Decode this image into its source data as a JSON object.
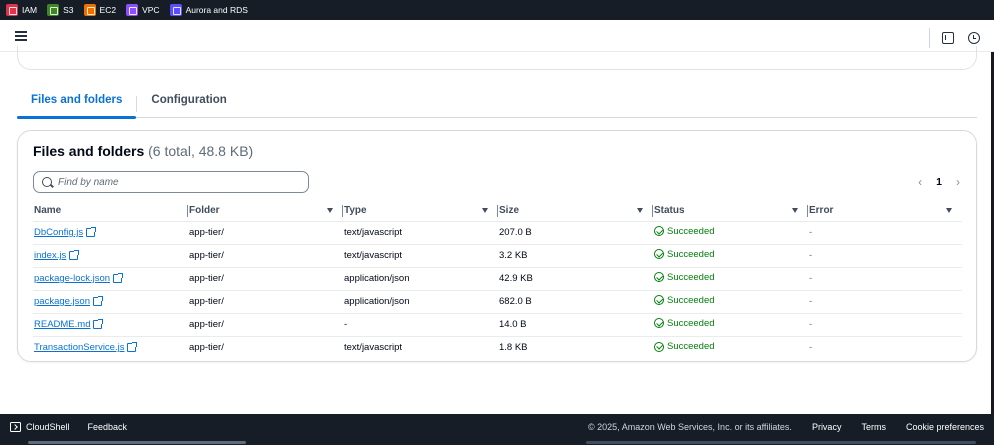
{
  "favorites": [
    {
      "label": "IAM",
      "color": "#dd344c"
    },
    {
      "label": "S3",
      "color": "#3f8624"
    },
    {
      "label": "EC2",
      "color": "#ed7100"
    },
    {
      "label": "VPC",
      "color": "#8c4fff"
    },
    {
      "label": "Aurora and RDS",
      "color": "#5a4fff"
    }
  ],
  "tabs": [
    {
      "label": "Files and folders",
      "active": true
    },
    {
      "label": "Configuration",
      "active": false
    }
  ],
  "card": {
    "title": "Files and folders",
    "count": "(6 total, 48.8 KB)"
  },
  "search": {
    "placeholder": "Find by name"
  },
  "pagination": {
    "page": "1"
  },
  "table": {
    "columns": [
      "Name",
      "Folder",
      "Type",
      "Size",
      "Status",
      "Error"
    ],
    "rows": [
      {
        "name": "DbConfig.js",
        "folder": "app-tier/",
        "type": "text/javascript",
        "size": "207.0 B",
        "status": "Succeeded",
        "error": "-"
      },
      {
        "name": "index.js",
        "folder": "app-tier/",
        "type": "text/javascript",
        "size": "3.2 KB",
        "status": "Succeeded",
        "error": "-"
      },
      {
        "name": "package-lock.json",
        "folder": "app-tier/",
        "type": "application/json",
        "size": "42.9 KB",
        "status": "Succeeded",
        "error": "-"
      },
      {
        "name": "package.json",
        "folder": "app-tier/",
        "type": "application/json",
        "size": "682.0 B",
        "status": "Succeeded",
        "error": "-"
      },
      {
        "name": "README.md",
        "folder": "app-tier/",
        "type": "-",
        "size": "14.0 B",
        "status": "Succeeded",
        "error": "-"
      },
      {
        "name": "TransactionService.js",
        "folder": "app-tier/",
        "type": "text/javascript",
        "size": "1.8 KB",
        "status": "Succeeded",
        "error": "-"
      }
    ]
  },
  "footer": {
    "cloudshell": "CloudShell",
    "feedback": "Feedback",
    "copyright": "© 2025, Amazon Web Services, Inc. or its affiliates.",
    "privacy": "Privacy",
    "terms": "Terms",
    "cookies": "Cookie preferences"
  }
}
